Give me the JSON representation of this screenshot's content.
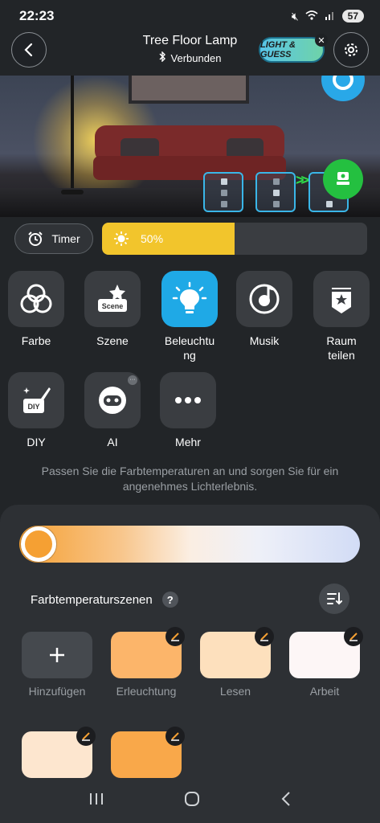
{
  "status_bar": {
    "time": "22:23",
    "battery": "57"
  },
  "header": {
    "title": "Tree Floor Lamp",
    "connection_status": "Verbunden",
    "game_badge": "LIGHT & GUESS"
  },
  "controls": {
    "timer_label": "Timer",
    "brightness_label": "50%",
    "brightness_level": 0.5
  },
  "features": [
    {
      "label": "Farbe",
      "icon": "color-circles-icon"
    },
    {
      "label": "Szene",
      "icon": "scene-icon"
    },
    {
      "label": "Beleuchtung",
      "icon": "bulb-icon",
      "active": true
    },
    {
      "label": "Musik",
      "icon": "music-icon"
    },
    {
      "label": "Raum teilen",
      "icon": "room-share-icon"
    },
    {
      "label": "DIY",
      "icon": "diy-icon"
    },
    {
      "label": "AI",
      "icon": "ai-icon"
    },
    {
      "label": "Mehr",
      "icon": "more-icon"
    }
  ],
  "scene_icon_text": "Scene",
  "diy_icon_text": "DIY",
  "hint_text": "Passen Sie die Farbtemperaturen an und sorgen Sie für ein angenehmes Lichterlebnis.",
  "sheet": {
    "scenes_title": "Farbtemperaturszenen",
    "help": "?",
    "scenes": [
      {
        "name": "Hinzufügen",
        "color": "#45494e"
      },
      {
        "name": "Erleuchtung",
        "color": "#fcb56a"
      },
      {
        "name": "Lesen",
        "color": "#fde0bd"
      },
      {
        "name": "Arbeit",
        "color": "#fdf6f6"
      },
      {
        "name": "",
        "color": "#fde6cf"
      },
      {
        "name": "",
        "color": "#f9a84a"
      }
    ]
  },
  "colors": {
    "accent": "#1fa9e6",
    "brightness": "#f2c52c",
    "active_green": "#24c040"
  }
}
